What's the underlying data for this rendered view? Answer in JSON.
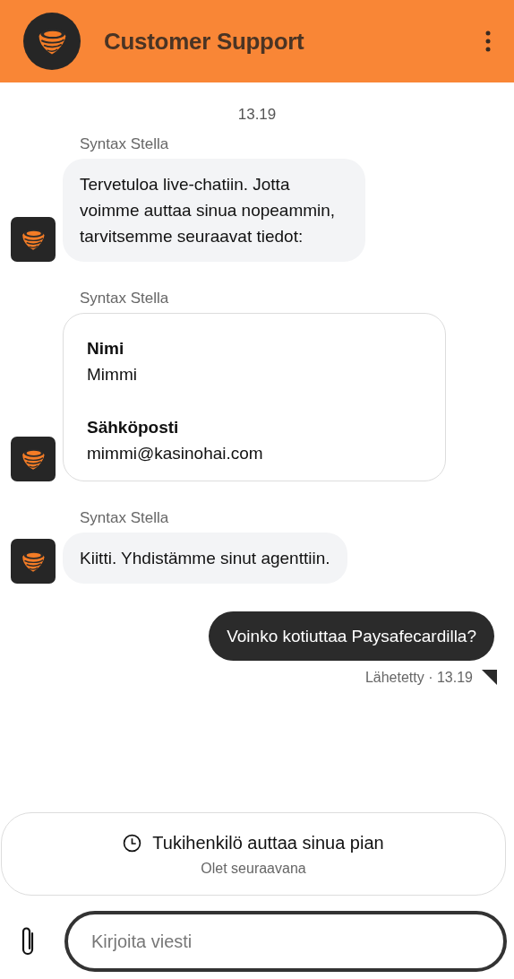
{
  "header": {
    "title": "Customer Support"
  },
  "timestamp": "13.19",
  "messages": [
    {
      "kind": "agent_text",
      "name": "Syntax Stella",
      "text": "Tervetuloa live-chatiin. Jotta voimme auttaa sinua nopeammin, tarvitsemme seuraavat tiedot:"
    },
    {
      "kind": "agent_form",
      "name": "Syntax Stella",
      "fields": [
        {
          "label": "Nimi",
          "value": "Mimmi"
        },
        {
          "label": "Sähköposti",
          "value": "mimmi@kasinohai.com"
        }
      ]
    },
    {
      "kind": "agent_text",
      "name": "Syntax Stella",
      "text": "Kiitti. Yhdistämme sinut agenttiin."
    },
    {
      "kind": "user_text",
      "text": "Voinko kotiuttaa Paysafecardilla?",
      "status": "Lähetetty · 13.19"
    }
  ],
  "queue": {
    "title": "Tukihenkilö auttaa sinua pian",
    "subtitle": "Olet seuraavana"
  },
  "composer": {
    "placeholder": "Kirjoita viesti"
  }
}
